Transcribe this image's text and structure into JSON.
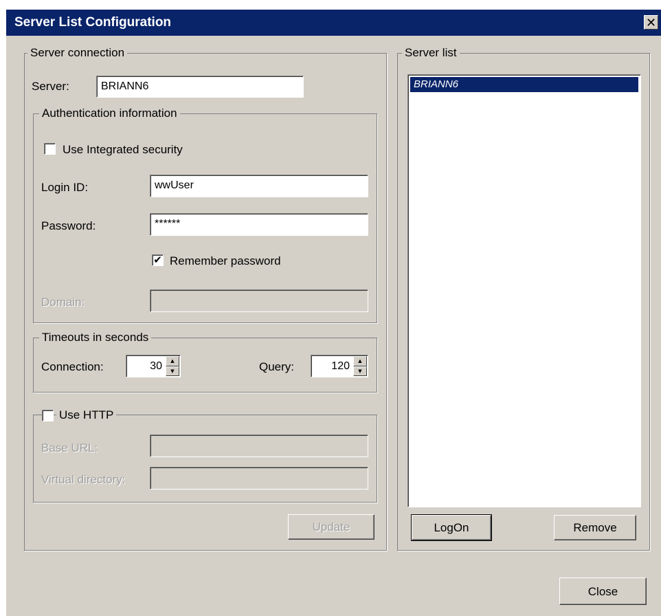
{
  "window": {
    "title": "Server List Configuration",
    "close_glyph": "✕"
  },
  "server_connection": {
    "legend": "Server connection",
    "server_label": "Server:",
    "server_value": "BRIANN6"
  },
  "authentication": {
    "legend": "Authentication information",
    "integrated_label": "Use Integrated security",
    "integrated_checked": false,
    "login_label": "Login ID:",
    "login_value": "wwUser",
    "password_label": "Password:",
    "password_value": "******",
    "remember_label": "Remember password",
    "remember_checked": true,
    "remember_glyph": "✔",
    "domain_label": "Domain:",
    "domain_value": ""
  },
  "timeouts": {
    "legend": "Timeouts in seconds",
    "connection_label": "Connection:",
    "connection_value": "30",
    "query_label": "Query:",
    "query_value": "120",
    "up_glyph": "▲",
    "down_glyph": "▼"
  },
  "http": {
    "legend": "Use HTTP",
    "checked": false,
    "base_url_label": "Base URL:",
    "base_url_value": "",
    "virtual_dir_label": "Virtual directory:",
    "virtual_dir_value": ""
  },
  "buttons": {
    "update": "Update",
    "logon": "LogOn",
    "remove": "Remove",
    "close": "Close"
  },
  "server_list": {
    "legend": "Server list",
    "items": [
      "BRIANN6"
    ]
  },
  "colors": {
    "title_bar": "#0a246a",
    "dialog_bg": "#d4d0c8",
    "selection": "#0a246a"
  }
}
